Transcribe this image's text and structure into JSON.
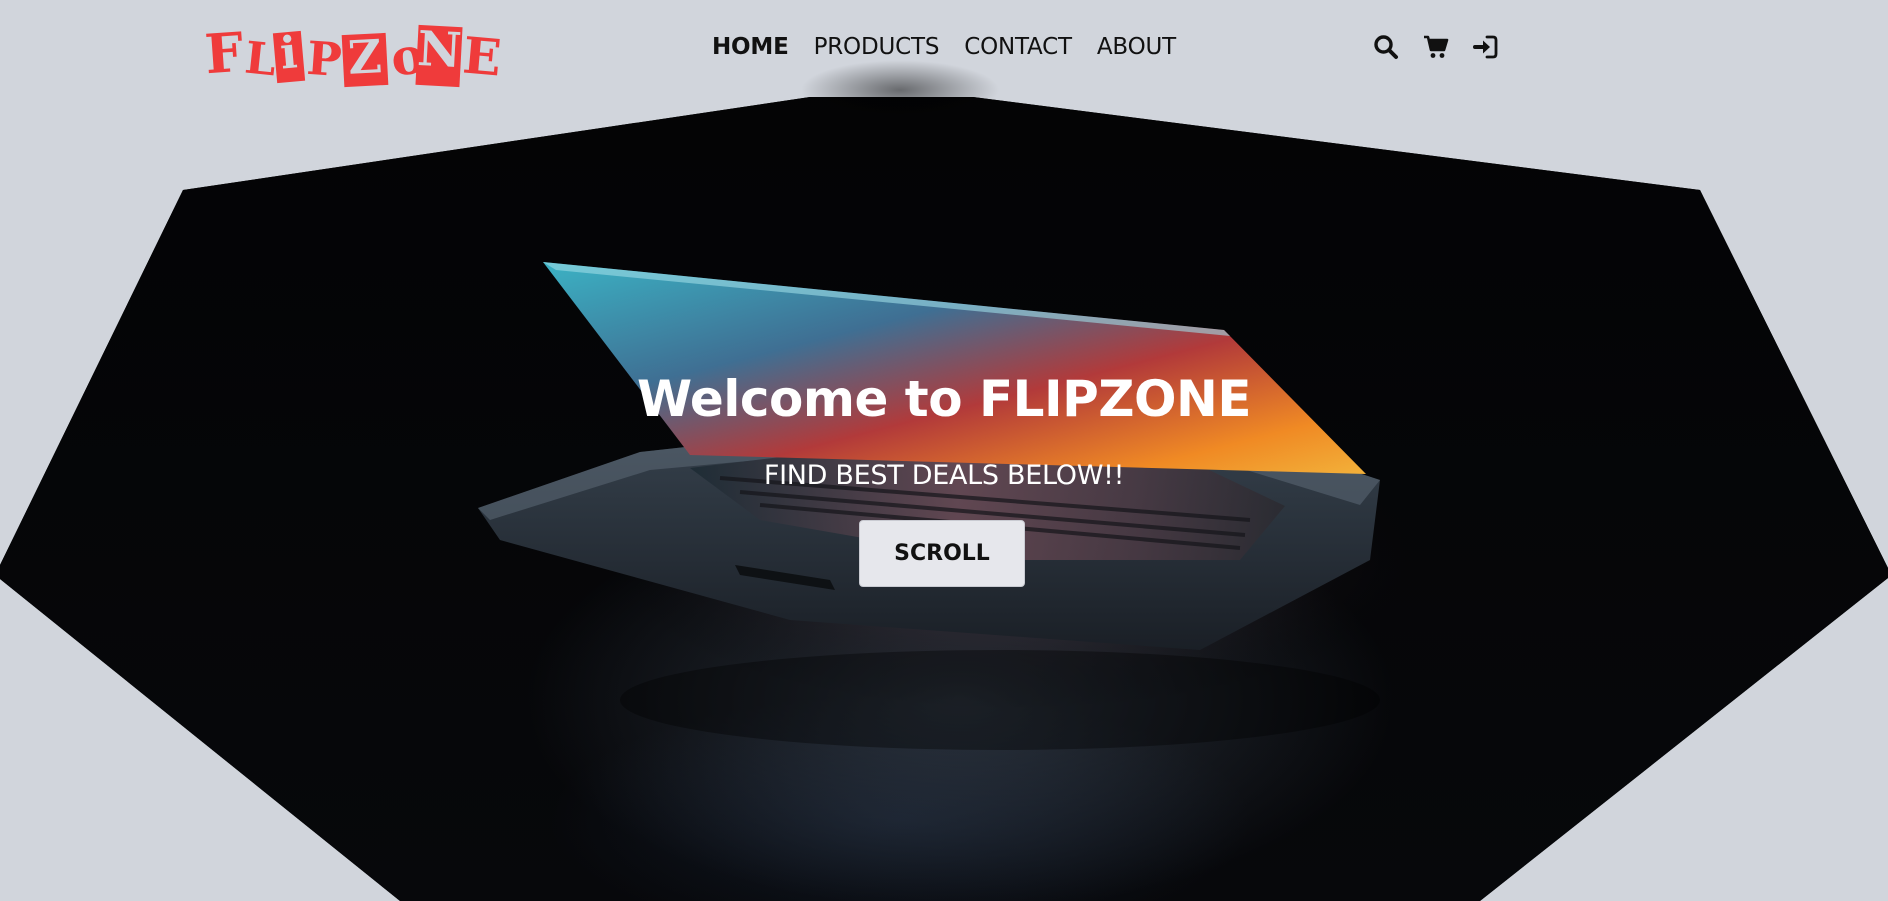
{
  "brand": {
    "logo_text": "FLIPZONE",
    "logo_color": "#ef3b3b"
  },
  "nav": {
    "links": [
      {
        "label": "HOME",
        "active": true
      },
      {
        "label": "PRODUCTS",
        "active": false
      },
      {
        "label": "CONTACT",
        "active": false
      },
      {
        "label": "ABOUT",
        "active": false
      }
    ],
    "icons": [
      "search-icon",
      "cart-icon",
      "login-icon"
    ]
  },
  "hero": {
    "title": "Welcome to FLIPZONE",
    "subtitle": "FIND BEST DEALS BELOW!!",
    "button_label": "SCROLL"
  },
  "colors": {
    "background": "#d1d5dc",
    "hero_dark": "#020203",
    "button_bg": "#e6e7ec",
    "text_dark": "#111111"
  }
}
